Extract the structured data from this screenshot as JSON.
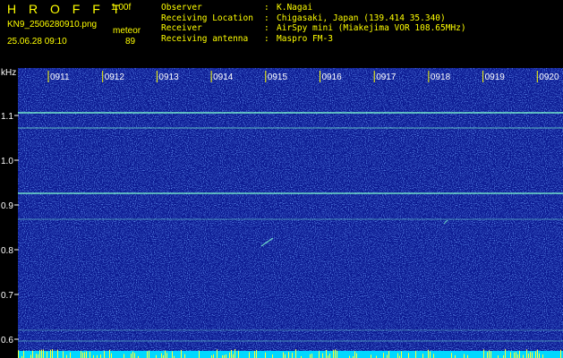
{
  "header": {
    "app_title": "H R O F F T",
    "version": "1.00f",
    "filename": "KN9_2506280910.png",
    "meteor_label": "meteor",
    "datetime": "25.06.28 09:10",
    "meteor_count": "89"
  },
  "info": [
    {
      "label": "Observer",
      "sep": ":",
      "value": "K.Nagai"
    },
    {
      "label": "Receiving Location",
      "sep": ":",
      "value": "Chigasaki, Japan (139.414 35.340)"
    },
    {
      "label": "Receiver",
      "sep": ":",
      "value": "AirSpy mini (Miakejima VOR 108.65MHz)"
    },
    {
      "label": "Receiving antenna",
      "sep": ":",
      "value": "Maspro FM-3"
    }
  ],
  "spectrogram": {
    "y_unit": "kHz",
    "y_ticks": [
      "1.1",
      "1.0",
      "0.9",
      "0.8",
      "0.7",
      "0.6"
    ],
    "x_ticks": [
      "0911",
      "0912",
      "0913",
      "0914",
      "0915",
      "0916",
      "0917",
      "0918",
      "0919",
      "0920"
    ],
    "colors": {
      "background": "#0a1890",
      "signal": "#7fffd0",
      "tick": "#ffff00"
    }
  }
}
